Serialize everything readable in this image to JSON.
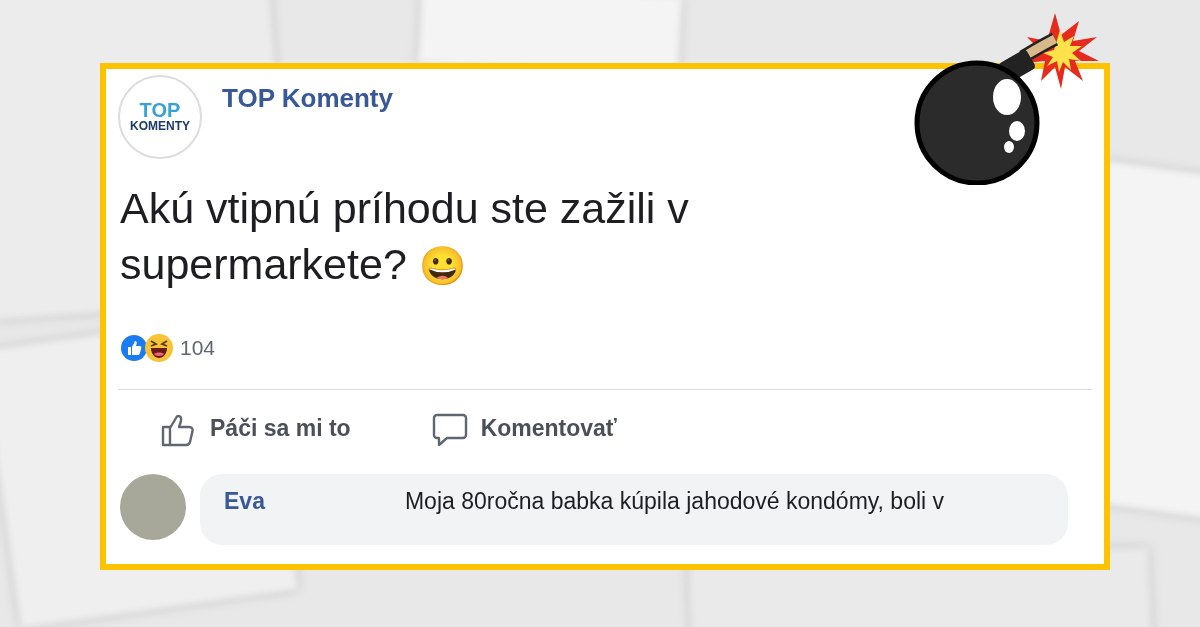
{
  "page": {
    "name": "TOP Komenty",
    "logo_lines": [
      "TOP",
      "KOMENTY"
    ]
  },
  "post": {
    "text": "Akú vtipnú príhodu ste zažili v supermarkete?",
    "emoji": "😀",
    "reaction_count": "104"
  },
  "actions": [
    {
      "kind": "like",
      "label": "Páči sa mi to"
    },
    {
      "kind": "comment",
      "label": "Komentovať"
    }
  ],
  "comment": {
    "author": "Eva",
    "text": "Moja 80ročna babka kúpila jahodové kondómy, boli v"
  }
}
